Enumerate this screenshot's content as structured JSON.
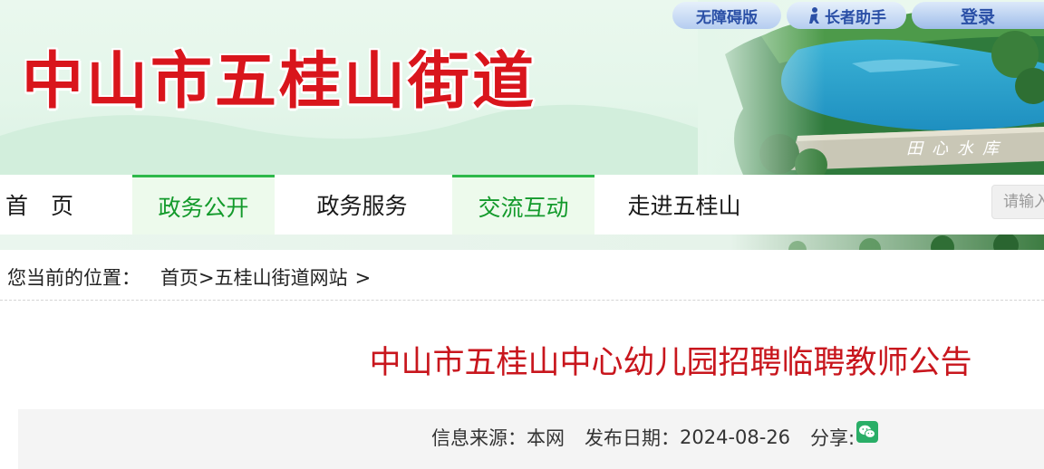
{
  "header": {
    "site_title": "中山市五桂山街道",
    "lake_sign": "田心水库",
    "accessibility_label": "无障碍版",
    "elder_mode_label": "长者助手",
    "login_label": "登录"
  },
  "nav": {
    "items": [
      {
        "label": "首　页",
        "active": false
      },
      {
        "label": "政务公开",
        "active": true
      },
      {
        "label": "政务服务",
        "active": false
      },
      {
        "label": "交流互动",
        "active": true
      },
      {
        "label": "走进五桂山",
        "active": false
      }
    ],
    "search_placeholder": "请输入"
  },
  "breadcrumb": {
    "label": "您当前的位置：",
    "items": [
      "首页",
      "五桂山街道网站"
    ],
    "separator": ">"
  },
  "article": {
    "title": "中山市五桂山中心幼儿园招聘临聘教师公告",
    "source_label": "信息来源：",
    "source": "本网",
    "date_label": "发布日期：",
    "date": "2024-08-26",
    "share_label": "分享:"
  },
  "colors": {
    "title_red": "#d9151c",
    "nav_active_green": "#139a2b",
    "article_title_red": "#c8161d"
  },
  "icons": {
    "elder": "elder-person-icon",
    "share": "wechat-icon"
  }
}
